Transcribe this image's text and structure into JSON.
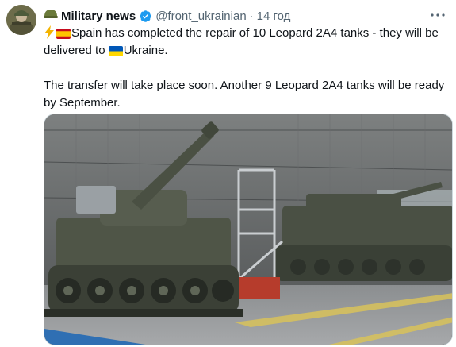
{
  "tweet": {
    "author_name": "Military news",
    "handle": "@front_ukrainian",
    "separator": "·",
    "time": "14 год",
    "more_icon": "more-horizontal-icon",
    "line1_part1": "Spain has completed the repair of 10 Leopard 2A4 tanks - they will be delivered to ",
    "line1_part2": "Ukraine.",
    "line2": "The transfer will take place soon. Another 9 Leopard 2A4 tanks will be ready by September."
  },
  "colors": {
    "text": "#0f1419",
    "secondary": "#536471",
    "verified": "#1d9bf0",
    "border": "#cfd9de"
  }
}
